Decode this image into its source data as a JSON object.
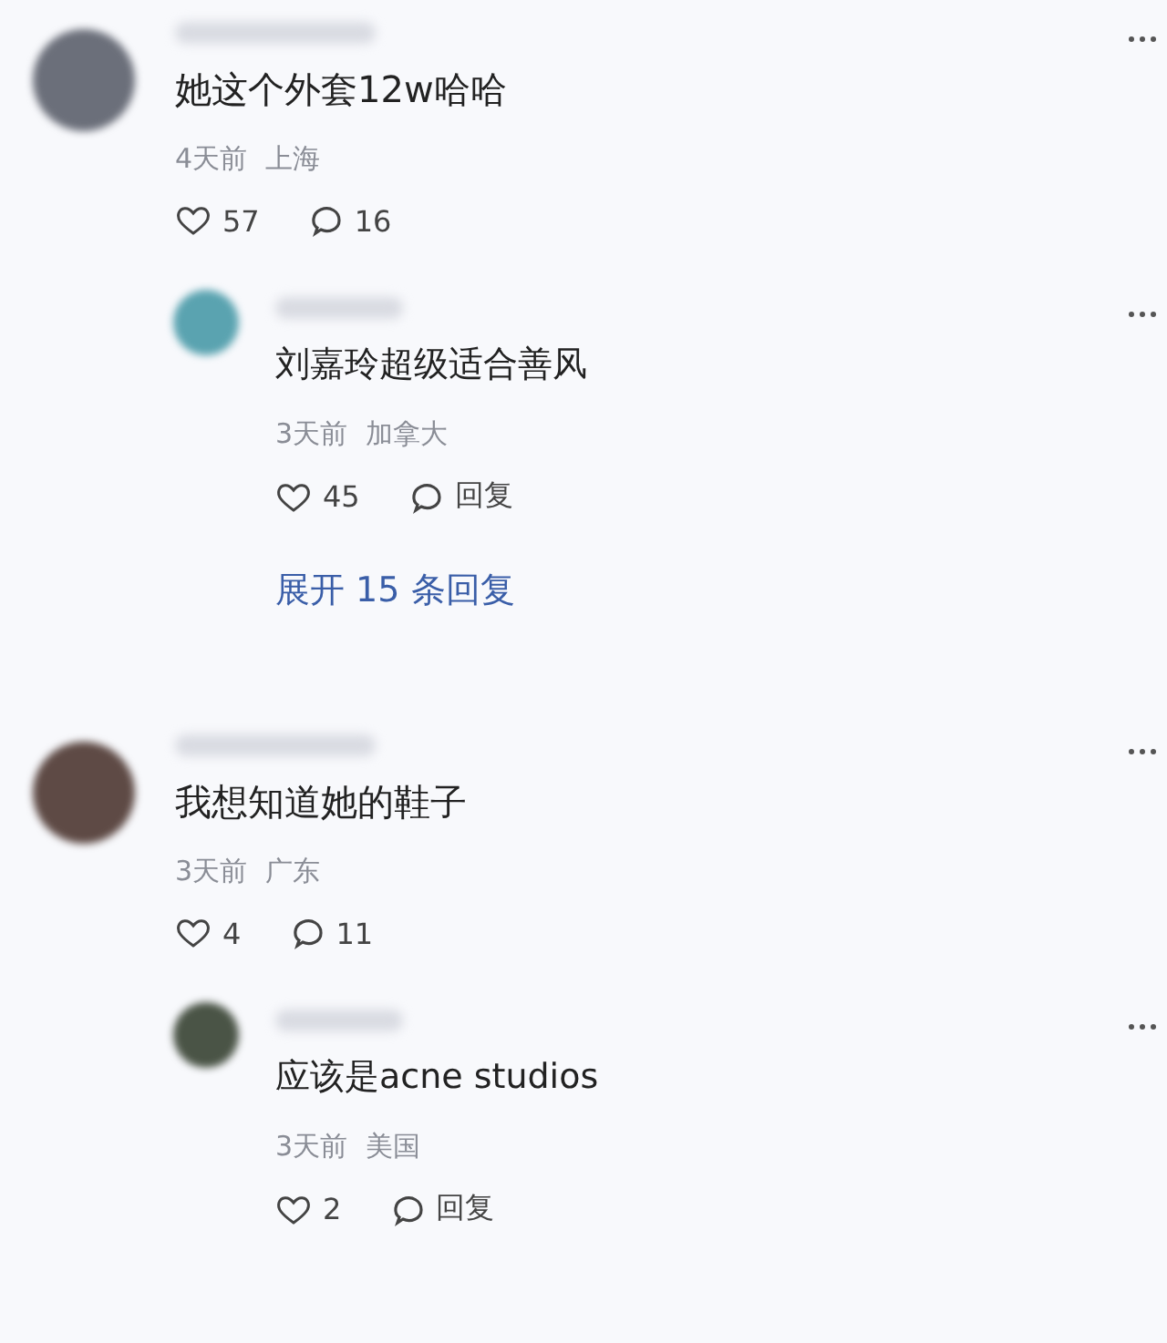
{
  "threads": [
    {
      "comment": {
        "color": "#6b6f7a",
        "text": "她这个外套12w哈哈",
        "time": "4天前",
        "location": "上海",
        "likes": "57",
        "replies": "16"
      },
      "replies": [
        {
          "color": "#5aa3b0",
          "text": "刘嘉玲超级适合善风",
          "time": "3天前",
          "location": "加拿大",
          "likes": "45",
          "replies": "回复"
        }
      ],
      "expand": "展开 15 条回复"
    },
    {
      "comment": {
        "color": "#5e4a45",
        "text": "我想知道她的鞋子",
        "time": "3天前",
        "location": "广东",
        "likes": "4",
        "replies": "11"
      },
      "replies": [
        {
          "color": "#4a5446",
          "text": "应该是acne studios",
          "time": "3天前",
          "location": "美国",
          "likes": "2",
          "replies": "回复"
        }
      ]
    }
  ]
}
